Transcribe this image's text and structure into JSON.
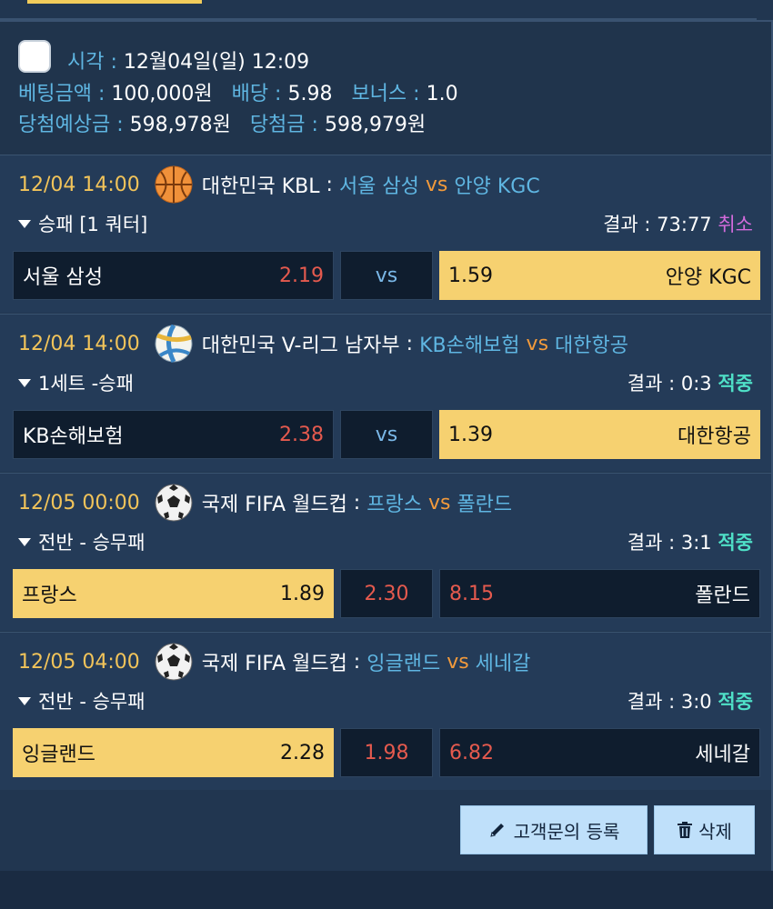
{
  "summary": {
    "time_label": "시각",
    "time_value": "12월04일(일) 12:09",
    "bet_amount_label": "베팅금액",
    "bet_amount_value": "100,000원",
    "odds_label": "배당",
    "odds_value": "5.98",
    "bonus_label": "보너스",
    "bonus_value": "1.0",
    "expected_label": "당첨예상금",
    "expected_value": "598,978원",
    "won_label": "당첨금",
    "won_value": "598,979원"
  },
  "bets": [
    {
      "time": "12/04 14:00",
      "sport_icon": "basketball-icon",
      "league": "대한민국 KBL",
      "home": "서울 삼성",
      "vs": "vs",
      "away": "안양 KGC",
      "market": "승패 [1 쿼터]",
      "result_label": "결과",
      "score": "73:77",
      "status": "취소",
      "home_odds": "2.19",
      "mid": "vs",
      "away_odds": "1.59"
    },
    {
      "time": "12/04 14:00",
      "sport_icon": "volleyball-icon",
      "league": "대한민국 V-리그 남자부",
      "home": "KB손해보험",
      "vs": "vs",
      "away": "대한항공",
      "market": "1세트 -승패",
      "result_label": "결과",
      "score": "0:3",
      "status": "적중",
      "home_odds": "2.38",
      "mid": "vs",
      "away_odds": "1.39"
    },
    {
      "time": "12/05 00:00",
      "sport_icon": "soccer-ball-icon",
      "league": "국제 FIFA 월드컵",
      "home": "프랑스",
      "vs": "vs",
      "away": "폴란드",
      "market": "전반 - 승무패",
      "result_label": "결과",
      "score": "3:1",
      "status": "적중",
      "home_odds": "1.89",
      "mid": "2.30",
      "away_odds": "8.15"
    },
    {
      "time": "12/05 04:00",
      "sport_icon": "soccer-ball-icon",
      "league": "국제 FIFA 월드컵",
      "home": "잉글랜드",
      "vs": "vs",
      "away": "세네갈",
      "market": "전반 - 승무패",
      "result_label": "결과",
      "score": "3:0",
      "status": "적중",
      "home_odds": "2.28",
      "mid": "1.98",
      "away_odds": "6.82"
    }
  ],
  "actions": {
    "inquiry_label": "고객문의 등록",
    "delete_label": "삭제"
  },
  "colors": {
    "background": "#213650",
    "accent_label": "#5fb6e2",
    "time": "#f2c45a",
    "selected": "#f6d170",
    "odds_red": "#e55a4e",
    "hit": "#4fe0c7",
    "cancel": "#d36bdc",
    "button": "#bfe0fa"
  }
}
